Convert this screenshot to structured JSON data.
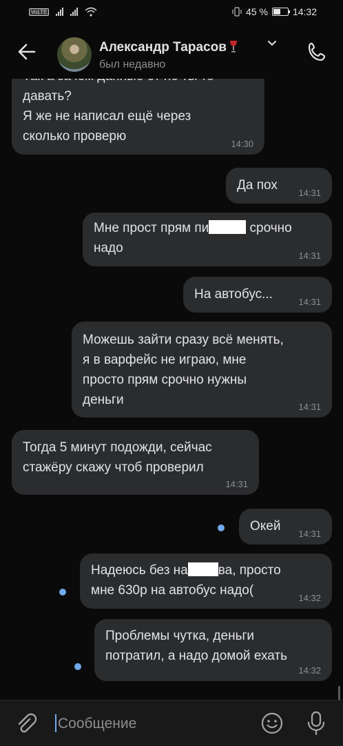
{
  "status_bar": {
    "volte": "VoLTE",
    "battery": "45 %",
    "time": "14:32"
  },
  "header": {
    "contact_name": "Александр Тарасов",
    "status": "был недавно"
  },
  "messages": [
    {
      "text": "Так а зачем данные от но ты то\nдавать?\nЯ же не написал ещё через\nсколько проверю",
      "time": "14:30",
      "incoming": true
    },
    {
      "text": "Да пох",
      "time": "14:31",
      "incoming": false
    },
    {
      "text_before": "Мне прост прям пи",
      "text_after": " срочно\nнадо",
      "time": "14:31",
      "incoming": false
    },
    {
      "text": "На автобус...",
      "time": "14:31",
      "incoming": false
    },
    {
      "text": "Можешь зайти сразу всё менять,\nя в варфейс не играю, мне\nпросто прям срочно нужны\nденьги",
      "time": "14:31",
      "incoming": false
    },
    {
      "text": "Тогда 5 минут подожди, сейчас\nстажёру скажу чтоб проверил",
      "time": "14:31",
      "incoming": true
    },
    {
      "text": "Окей",
      "time": "14:31",
      "incoming": false,
      "unread": true
    },
    {
      "text_before": "Надеюсь без на",
      "text_after": "ва, просто\nмне 630р на автобус надо(",
      "time": "14:32",
      "incoming": false,
      "unread": true
    },
    {
      "text": "Проблемы чутка, деньги\nпотратил, а надо домой ехать",
      "time": "14:32",
      "incoming": false,
      "unread": true
    }
  ],
  "composer": {
    "placeholder": "Сообщение"
  },
  "colors": {
    "background": "#0a0a0a",
    "bubble": "#2b2c2e",
    "text": "#e1e3e6",
    "secondary": "#8c8e91",
    "accent": "#71aaeb",
    "composer": "#191919"
  }
}
